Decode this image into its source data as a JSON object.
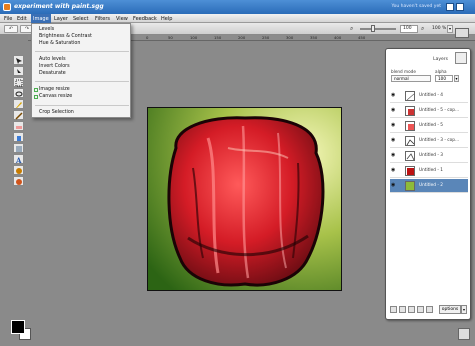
{
  "window": {
    "title": "experiment with paint.sgg",
    "saved_status": "You haven't saved yet"
  },
  "menubar": {
    "items": [
      "File",
      "Edit",
      "Image",
      "Layer",
      "Select",
      "Filters",
      "View",
      "Feedback",
      "Help"
    ],
    "active": "Image"
  },
  "toolbar": {
    "slider_value": "100",
    "zoom": "100 %"
  },
  "ruler": {
    "ticks": [
      "0",
      "50",
      "100",
      "150",
      "200",
      "250",
      "300",
      "350",
      "400",
      "450",
      "500",
      "550",
      "600",
      "650"
    ]
  },
  "image_menu": {
    "group1": [
      "Levels",
      "Brightness & Contrast",
      "Hue & Saturation"
    ],
    "group2": [
      "Auto levels",
      "Invert Colors",
      "Desaturate"
    ],
    "group3": [
      "Image resize",
      "Canvas resize"
    ],
    "group4": [
      "Crop Selection"
    ]
  },
  "layers_panel": {
    "title": "Layers",
    "blend_mode_label": "blend mode",
    "alpha_label": "alpha",
    "blend_mode": "normal",
    "alpha": "100",
    "layers": [
      {
        "name": "Untitled - 4",
        "selected": false
      },
      {
        "name": "Untitled - 5 - cop...",
        "selected": false
      },
      {
        "name": "Untitled - 5",
        "selected": false
      },
      {
        "name": "Untitled - 3 - cop...",
        "selected": false
      },
      {
        "name": "Untitled - 3",
        "selected": false
      },
      {
        "name": "Untitled - 1",
        "selected": false
      },
      {
        "name": "Untitled - 2",
        "selected": true
      }
    ],
    "options_label": "options"
  },
  "colors": {
    "foreground": "#000000",
    "background": "#ffffff",
    "accent": "#3a6fb5",
    "selected_layer": "#5a86b8"
  },
  "icons": [
    "app-icon",
    "undo-icon",
    "redo-icon",
    "zoom-out-icon",
    "zoom-in-icon",
    "eye-icon",
    "layers-icon"
  ]
}
